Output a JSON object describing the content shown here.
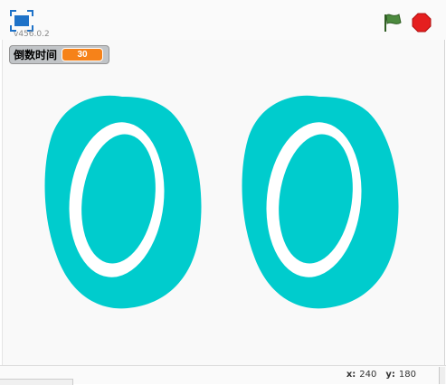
{
  "player": {
    "version": "v456.0.2",
    "colors": {
      "monitor_value_bg": "#f68219",
      "digit_color": "#00cccd",
      "flag_green": "#4c8a3e",
      "stop_red": "#e51f1f",
      "fullscreen_blue": "#1e72c8"
    }
  },
  "toolbar": {
    "fullscreen_icon": "fullscreen-icon",
    "green_flag_icon": "green-flag-icon",
    "stop_icon": "stop-sign-icon"
  },
  "monitor": {
    "label": "倒数时间",
    "value": "30"
  },
  "stage": {
    "display_text": "00"
  },
  "status": {
    "x_label": "x:",
    "x_value": "240",
    "y_label": "y:",
    "y_value": "180"
  }
}
